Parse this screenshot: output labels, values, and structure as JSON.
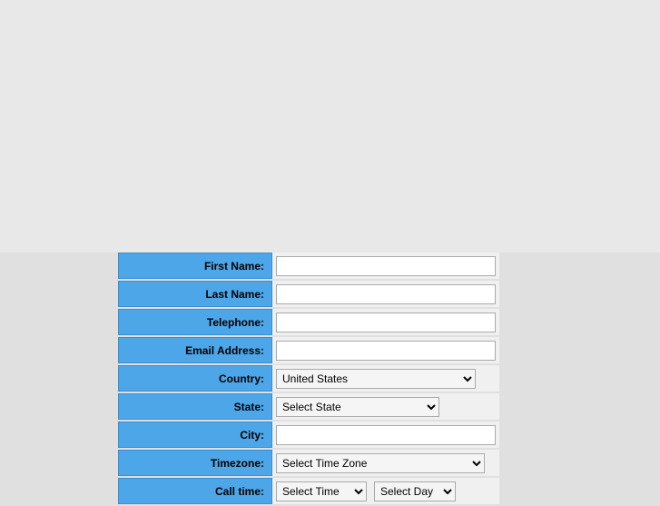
{
  "form": {
    "fields": {
      "first_name": {
        "label": "First Name:",
        "placeholder": ""
      },
      "last_name": {
        "label": "Last Name:",
        "placeholder": ""
      },
      "telephone": {
        "label": "Telephone:",
        "placeholder": ""
      },
      "email": {
        "label": "Email Address:",
        "placeholder": ""
      },
      "country": {
        "label": "Country:",
        "value": "United States"
      },
      "state": {
        "label": "State:",
        "placeholder": "Select State"
      },
      "city": {
        "label": "City:",
        "placeholder": ""
      },
      "timezone": {
        "label": "Timezone:",
        "placeholder": "Select Time Zone"
      },
      "call_time": {
        "label": "Call time:",
        "time_placeholder": "Select Time",
        "day_placeholder": "Select Day"
      }
    },
    "country_options": [
      "United States"
    ],
    "state_options": [
      "Select State"
    ],
    "timezone_options": [
      "Select Time Zone"
    ],
    "time_options": [
      "Select Time"
    ],
    "day_options": [
      "Select Day"
    ]
  }
}
